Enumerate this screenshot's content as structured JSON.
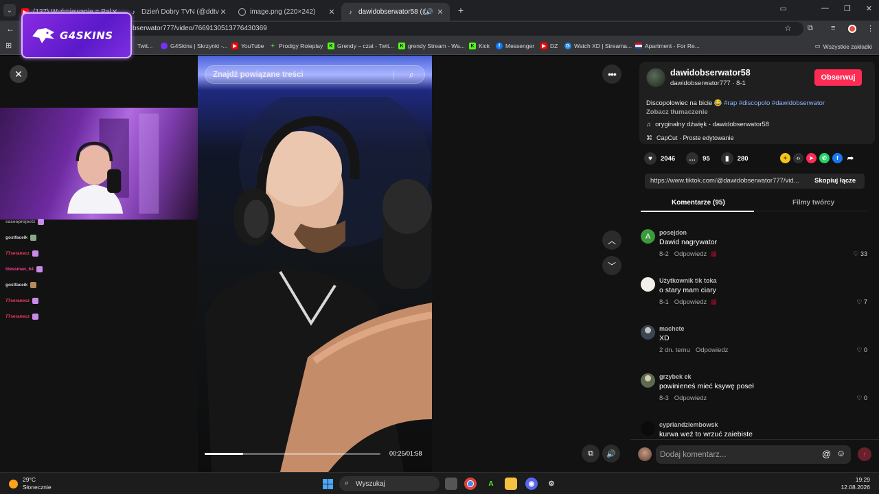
{
  "browser": {
    "tabs": [
      {
        "title": "(137) Wyśmiewanie = Paliwo",
        "fav_color": "#ff0000",
        "active": false
      },
      {
        "title": "Dzień Dobry TVN (@ddtvn) | Tik",
        "fav_color": "#111111",
        "active": false
      },
      {
        "title": "image.png (220×242)",
        "fav_color": "#666666",
        "active": false
      },
      {
        "title": "dawidobserwator58 (@daw",
        "fav_color": "#111111",
        "active": true
      }
    ],
    "new_tab_label": "+",
    "url": "bserwator777/video/7669130513776430369",
    "bookmarks": [
      {
        "label": "Twit...",
        "color": "#9146ff"
      },
      {
        "label": "G4Skins | Skrzynki -...",
        "color": "#7b2ff7"
      },
      {
        "label": "YouTube",
        "color": "#ff0000"
      },
      {
        "label": "Prodigy Roleplay",
        "color": "#5bc236"
      },
      {
        "label": "Grendy – czat - Twit...",
        "color": "#53fc18"
      },
      {
        "label": "grendy Stream - Wa...",
        "color": "#53fc18"
      },
      {
        "label": "Kick",
        "color": "#53fc18"
      },
      {
        "label": "Messenger",
        "color": "#0a7cff"
      },
      {
        "label": "DZ",
        "color": "#ff0000"
      },
      {
        "label": "Watch XD | Streama...",
        "color": "#1e88e5"
      },
      {
        "label": "Apartment - For Re...",
        "color": "#c8102e"
      }
    ],
    "all_bookmarks": "Wszystkie zakładki",
    "profile_badge": "884"
  },
  "overlay": {
    "logo_text": "G4SKINS",
    "chat": [
      {
        "user": "caseoprojectz",
        "color": "#9a9a9a"
      },
      {
        "user": "gostfaceik",
        "color": "#d8d8d8"
      },
      {
        "user": "77seranecz",
        "color": "#ff3b5c"
      },
      {
        "user": "tilessman_64",
        "color": "#ff3b9a"
      },
      {
        "user": "gostfaceik",
        "color": "#d8d8d8"
      },
      {
        "user": "77seranecz",
        "color": "#ff3b5c"
      },
      {
        "user": "77seranecz",
        "color": "#ff3b5c"
      }
    ]
  },
  "video": {
    "search_placeholder": "Znajdź powiązane treści",
    "time": "00:25/01:58",
    "progress": 0.22
  },
  "author": {
    "username": "dawidobserwator58",
    "nickname": "dawidobserwator777 · 8-1",
    "follow_label": "Obserwuj",
    "description": "Discopolowiec na bicie 😂",
    "hashtags": "#rap #discopolo #dawidobserwator",
    "translate": "Zobacz tłumaczenie",
    "sound": "oryginalny dźwięk - dawidobserwator58",
    "capcut": "CapCut · Proste edytowanie"
  },
  "stats": {
    "likes": "2046",
    "comments": "95",
    "saves": "280"
  },
  "link": {
    "url": "https://www.tiktok.com/@dawidobserwator777/vid...",
    "copy_label": "Skopiuj łącze"
  },
  "tabs": {
    "comments": "Komentarze (95)",
    "creator": "Filmy twórcy"
  },
  "comments": [
    {
      "user": "posejdon",
      "text": "Dawid nagrywator",
      "date": "8-2",
      "likes": "33",
      "avatar_letter": "A",
      "avatar_color": "#3c9a3c"
    },
    {
      "user": "Użytkownik tik toka",
      "text": "o stary mam ciary",
      "date": "8-1",
      "likes": "7",
      "avatar_letter": "",
      "avatar_color": "#f2f0e8"
    },
    {
      "user": "machete",
      "text": "XD",
      "date": "2 dn. temu",
      "likes": "0",
      "avatar_letter": "",
      "avatar_color": "#5a6470"
    },
    {
      "user": "grzybek ek",
      "text": "powinieneś mieć ksywę poseł",
      "date": "8-3",
      "likes": "0",
      "avatar_letter": "",
      "avatar_color": "#6e7a5e"
    },
    {
      "user": "cypriandziembowsk",
      "text": "kurwa weź to wrzuć zajebiste",
      "date": "",
      "likes": "",
      "avatar_letter": "",
      "avatar_color": "#0b0b0b"
    }
  ],
  "reply_label": "Odpowiedz",
  "add_comment_placeholder": "Dodaj komentarz...",
  "taskbar": {
    "temp": "29°C",
    "weather": "Słonecznie",
    "search": "Wyszukaj",
    "time": "19:29",
    "date": "12.08.2026"
  }
}
